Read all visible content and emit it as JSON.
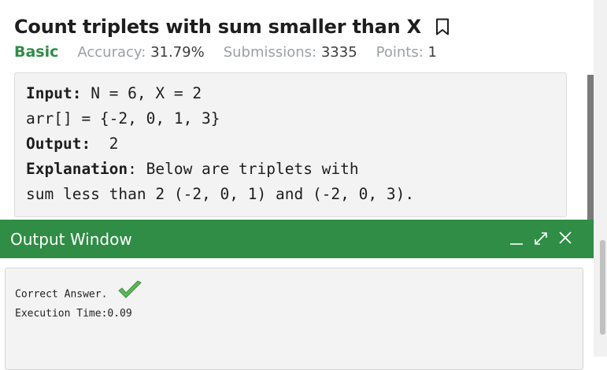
{
  "problem": {
    "title": "Count triplets with sum smaller than X",
    "difficulty": "Basic",
    "accuracy_label": "Accuracy:",
    "accuracy_value": "31.79%",
    "submissions_label": "Submissions:",
    "submissions_value": "3335",
    "points_label": "Points:",
    "points_value": "1"
  },
  "example": {
    "input_label": "Input:",
    "input_value": " N = 6, X = 2",
    "arr_line": "arr[] = {-2, 0, 1, 3}",
    "output_label": "Output:",
    "output_value": "  2",
    "explanation_label": "Explanation",
    "explanation_text": ": Below are triplets with",
    "explanation_line2": "sum less than 2 (-2, 0, 1) and (-2, 0, 3)."
  },
  "output_window": {
    "title": "Output Window",
    "result_text": "Correct Answer.",
    "execution_time": "Execution Time:0.09"
  },
  "colors": {
    "brand_green": "#2f8d46",
    "check_green": "#5cb85c"
  },
  "icons": {
    "bookmark": "bookmark-icon",
    "minimize": "minimize-icon",
    "expand": "expand-icon",
    "close": "close-icon",
    "check": "checkmark-icon"
  }
}
